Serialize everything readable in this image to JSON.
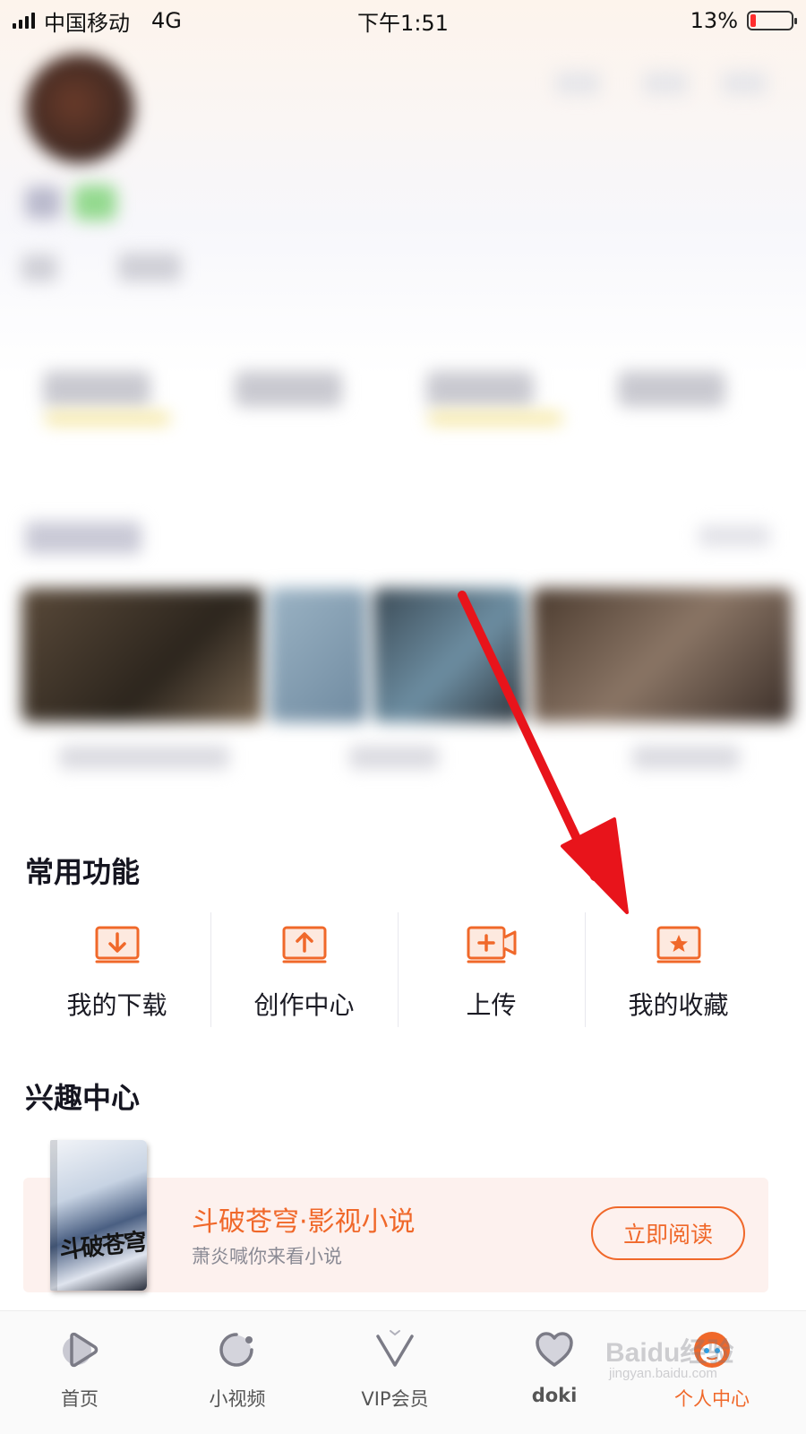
{
  "status_bar": {
    "carrier": "中国移动",
    "network": "4G",
    "time": "下午1:51",
    "battery_percent": "13%",
    "battery_level": 0.13,
    "battery_color": "#ff2d2d"
  },
  "common_functions": {
    "title": "常用功能",
    "items": [
      {
        "label": "我的下载",
        "icon": "download-icon"
      },
      {
        "label": "创作中心",
        "icon": "upload-icon"
      },
      {
        "label": "上传",
        "icon": "video-add-icon"
      },
      {
        "label": "我的收藏",
        "icon": "favorite-star-icon"
      }
    ]
  },
  "interest_center": {
    "title": "兴趣中心",
    "card": {
      "book_cover_text": "斗破苍穹",
      "title": "斗破苍穹·影视小说",
      "subtitle": "萧炎喊你来看小说",
      "button": "立即阅读"
    }
  },
  "tab_bar": {
    "items": [
      {
        "label": "首页",
        "icon": "home-play-icon",
        "active": false
      },
      {
        "label": "小视频",
        "icon": "short-video-icon",
        "active": false
      },
      {
        "label": "VIP会员",
        "icon": "vip-icon",
        "active": false
      },
      {
        "label": "doki",
        "icon": "doki-heart-icon",
        "active": false
      },
      {
        "label": "个人中心",
        "icon": "profile-mascot-icon",
        "active": true
      }
    ]
  },
  "watermark": {
    "brand": "Baidu经验",
    "url": "jingyan.baidu.com"
  },
  "colors": {
    "accent": "#f0682a",
    "annotation_arrow": "#e8141b"
  }
}
